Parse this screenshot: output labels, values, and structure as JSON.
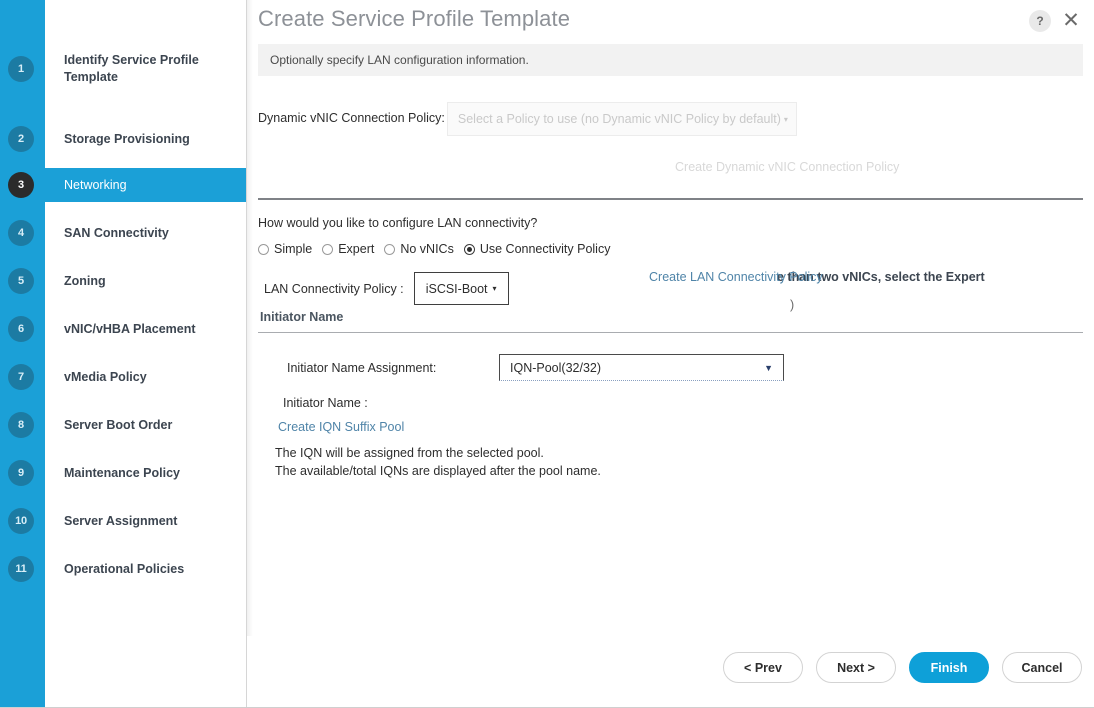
{
  "window": {
    "title": "Create Service Profile Template",
    "subtitle": "Optionally specify LAN configuration information.",
    "help_icon_label": "?",
    "close_icon_label": "✕"
  },
  "colors": {
    "accent_blue": "#1ba0d7",
    "primary_button": "#0ea0d8",
    "step_circle_inactive": "#1c7ba3",
    "step_circle_active": "#2b2b2b",
    "link": "#4f84a8"
  },
  "sidebar": {
    "items": [
      {
        "number": "1",
        "label": "Identify Service Profile Template",
        "active": false
      },
      {
        "number": "2",
        "label": "Storage Provisioning",
        "active": false
      },
      {
        "number": "3",
        "label": "Networking",
        "active": true
      },
      {
        "number": "4",
        "label": "SAN Connectivity",
        "active": false
      },
      {
        "number": "5",
        "label": "Zoning",
        "active": false
      },
      {
        "number": "6",
        "label": "vNIC/vHBA Placement",
        "active": false
      },
      {
        "number": "7",
        "label": "vMedia Policy",
        "active": false
      },
      {
        "number": "8",
        "label": "Server Boot Order",
        "active": false
      },
      {
        "number": "9",
        "label": "Maintenance Policy",
        "active": false
      },
      {
        "number": "10",
        "label": "Server Assignment",
        "active": false
      },
      {
        "number": "11",
        "label": "Operational Policies",
        "active": false
      }
    ]
  },
  "form": {
    "dynamic_vnic_label": "Dynamic vNIC Connection Policy:",
    "dynamic_vnic_value": "Select a Policy to use (no Dynamic vNIC Policy by default)",
    "dynamic_vnic_caret": "▾",
    "create_dynamic_vnic_link": "Create Dynamic vNIC Connection Policy",
    "question": "How would you like to configure LAN connectivity?",
    "radios": [
      {
        "label": "Simple",
        "selected": false
      },
      {
        "label": "Expert",
        "selected": false
      },
      {
        "label": "No vNICs",
        "selected": false
      },
      {
        "label": "Use Connectivity Policy",
        "selected": true
      }
    ],
    "lan_policy_label": "LAN Connectivity Policy :",
    "lan_policy_value": "iSCSI-Boot",
    "lan_policy_caret": "▾",
    "create_lan_policy_link": "Create LAN Connectivity Policy",
    "overlap_note": "e than two vNICs, select the Expert",
    "overlap_paren": ")",
    "initiator_section_heading": "Initiator Name",
    "initiator_assignment_label": "Initiator Name Assignment:",
    "initiator_assignment_value": "IQN-Pool(32/32)",
    "initiator_assignment_caret": "▼",
    "initiator_name_label": "Initiator Name :",
    "create_iqn_link": "Create IQN Suffix Pool",
    "helper_line_1": "The IQN will be assigned from the selected pool.",
    "helper_line_2": "The available/total IQNs are displayed after the pool name."
  },
  "footer": {
    "buttons": [
      {
        "label": "< Prev",
        "primary": false,
        "name": "prev-button"
      },
      {
        "label": "Next >",
        "primary": false,
        "name": "next-button"
      },
      {
        "label": "Finish",
        "primary": true,
        "name": "finish-button"
      },
      {
        "label": "Cancel",
        "primary": false,
        "name": "cancel-button"
      }
    ]
  }
}
